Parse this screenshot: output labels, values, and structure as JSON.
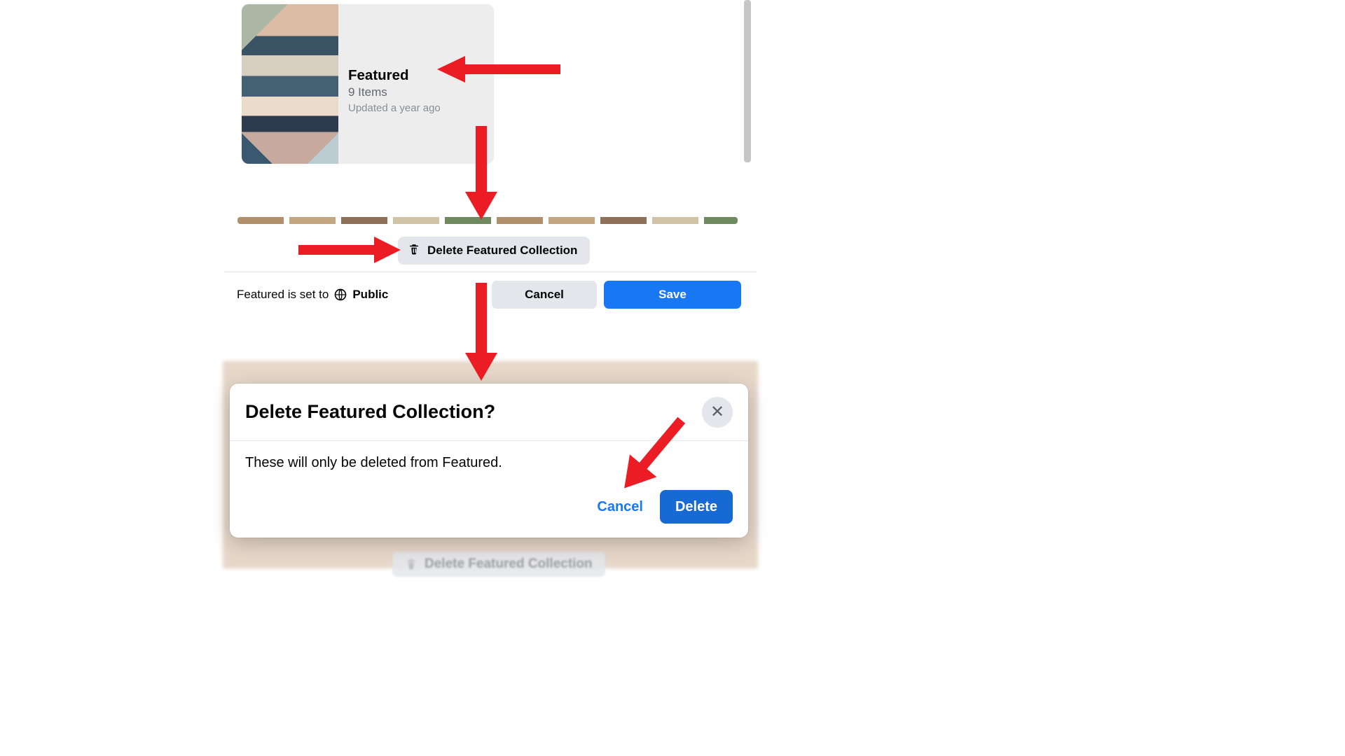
{
  "card": {
    "title": "Featured",
    "items_line": "9 Items",
    "updated_line": "Updated a year ago"
  },
  "delete_chip": {
    "label": "Delete Featured Collection"
  },
  "privacy": {
    "prefix": "Featured is set to",
    "level": "Public"
  },
  "buttons": {
    "cancel": "Cancel",
    "save": "Save"
  },
  "modal": {
    "title": "Delete Featured Collection?",
    "body": "These will only be deleted from Featured.",
    "cancel": "Cancel",
    "delete": "Delete"
  },
  "ghost_chip": {
    "label": "Delete Featured Collection"
  },
  "colors": {
    "accent": "#1877f2",
    "annotation": "#ec1c24"
  }
}
